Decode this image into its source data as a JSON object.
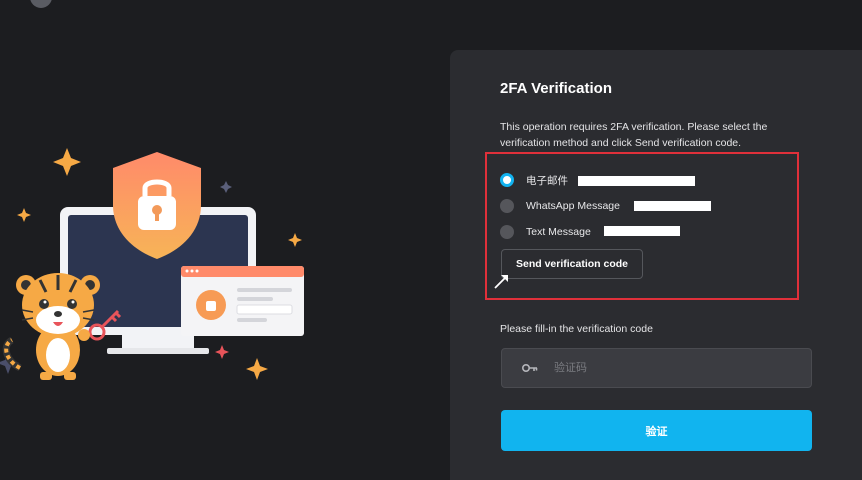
{
  "panel": {
    "title": "2FA Verification",
    "description": "This operation requires 2FA verification. Please select the verification method and click Send verification code.",
    "methods": [
      {
        "label": "电子邮件",
        "selected": true
      },
      {
        "label": "WhatsApp Message",
        "selected": false
      },
      {
        "label": "Text Message",
        "selected": false
      }
    ],
    "send_button": "Send verification code",
    "fill_label": "Please fill-in the verification code",
    "code_placeholder": "验证码",
    "verify_button": "验证"
  },
  "colors": {
    "accent": "#11b4ef",
    "highlight_border": "#e0303a",
    "panel_bg": "#2b2c30",
    "page_bg": "#1c1d20"
  },
  "icons": [
    "key-icon",
    "shield-lock-icon",
    "tiger-mascot",
    "sparkle-icon",
    "pointer-arrow-icon"
  ]
}
